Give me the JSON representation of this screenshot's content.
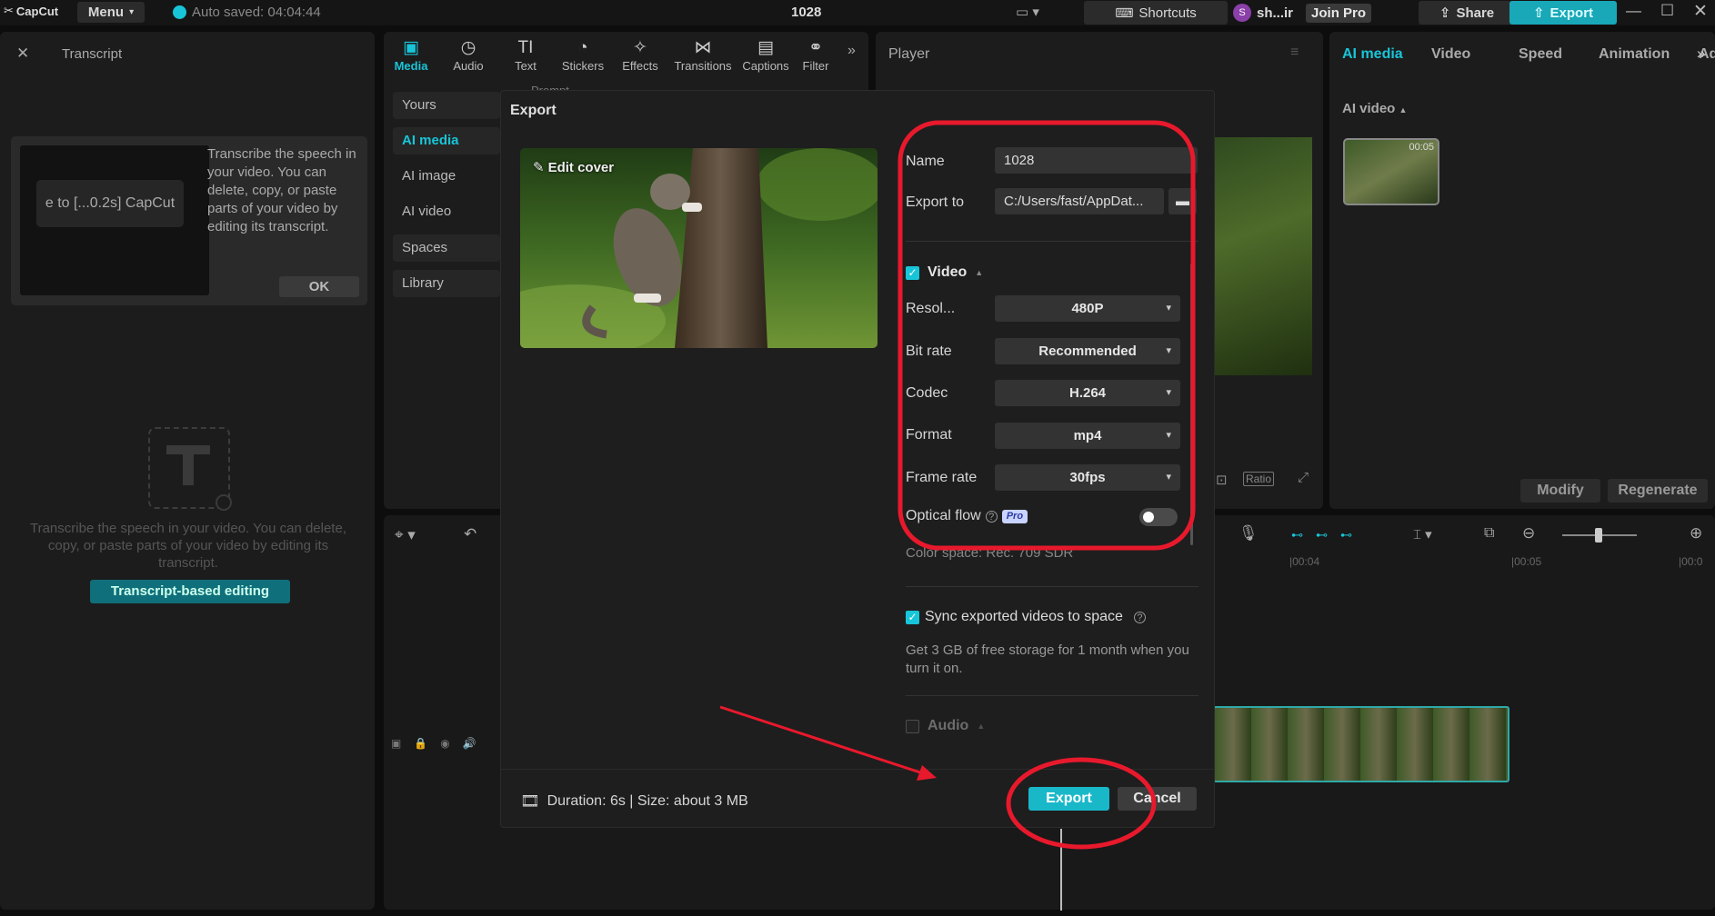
{
  "app": {
    "logo": "CapCut",
    "menu": "Menu",
    "autosave": "Auto saved: 04:04:44",
    "project_title": "1028",
    "shortcuts": "Shortcuts",
    "user_initial": "S",
    "user_name": "sh...ir",
    "join_pro": "Join Pro",
    "share": "Share",
    "export": "Export"
  },
  "transcript": {
    "title": "Transcript",
    "tooltip_text": "Transcribe the speech in your video. You can delete, copy, or paste parts of your video by editing its transcript.",
    "tooltip_preview": "e to [...0.2s] CapCut",
    "ok": "OK",
    "empty_text": "Transcribe the speech in your video. You can delete, copy, or paste parts of your video by editing its transcript.",
    "button": "Transcript-based editing"
  },
  "media_tabs": [
    {
      "label": "Media",
      "icon": "media-icon"
    },
    {
      "label": "Audio",
      "icon": "audio-icon"
    },
    {
      "label": "Text",
      "icon": "text-icon"
    },
    {
      "label": "Stickers",
      "icon": "stickers-icon"
    },
    {
      "label": "Effects",
      "icon": "effects-icon"
    },
    {
      "label": "Transitions",
      "icon": "transitions-icon"
    },
    {
      "label": "Captions",
      "icon": "captions-icon"
    },
    {
      "label": "Filter",
      "icon": "filter-icon"
    }
  ],
  "media_side": [
    "Yours",
    "AI media",
    "AI image",
    "AI video",
    "Spaces",
    "Library"
  ],
  "media_partial": "Prompt",
  "player": {
    "title": "Player",
    "ratio": "Ratio"
  },
  "right": {
    "tabs": [
      "AI media",
      "Video",
      "Speed",
      "Animation",
      "Adjust"
    ],
    "section": "AI video",
    "thumb_time": "00:05",
    "modify": "Modify",
    "regenerate": "Regenerate"
  },
  "timeline": {
    "t1": "|00:04",
    "t2": "|00:05",
    "t3": "|00:0"
  },
  "export": {
    "title": "Export",
    "edit_cover": "Edit cover",
    "name_label": "Name",
    "name_value": "1028",
    "export_to_label": "Export to",
    "export_to_value": "C:/Users/fast/AppDat...",
    "video_label": "Video",
    "rows": [
      {
        "label": "Resol...",
        "value": "480P"
      },
      {
        "label": "Bit rate",
        "value": "Recommended"
      },
      {
        "label": "Codec",
        "value": "H.264"
      },
      {
        "label": "Format",
        "value": "mp4"
      },
      {
        "label": "Frame rate",
        "value": "30fps"
      }
    ],
    "optical_flow": "Optical flow",
    "pro": "Pro",
    "color_space": "Color space: Rec. 709 SDR",
    "sync_label": "Sync exported videos to space",
    "sync_desc": "Get 3 GB of free storage for 1 month when you turn it on.",
    "audio_label": "Audio",
    "duration": "Duration: 6s | Size: about 3 MB",
    "export_btn": "Export",
    "cancel_btn": "Cancel"
  },
  "colors": {
    "accent": "#18c5d8",
    "annotation": "#e8192c",
    "bg": "#0d0d0d",
    "panel": "#1c1c1c"
  }
}
